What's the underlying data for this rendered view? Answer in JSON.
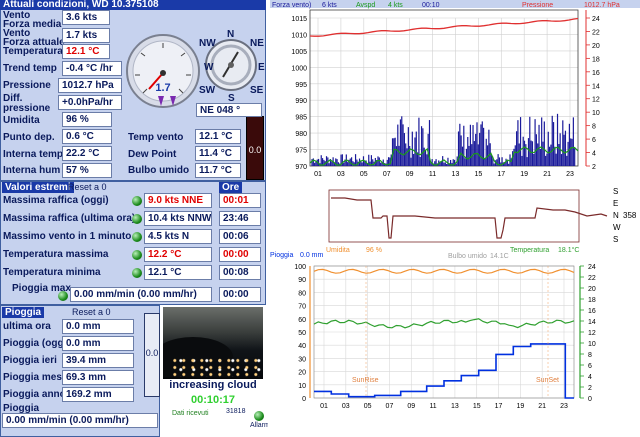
{
  "title": "Attuali condizioni, WD 10.375108",
  "current": {
    "wind_label": "Vento",
    "wind_mean_label": "Forza media",
    "wind_mean_value": "3.6 kts",
    "wind_now_label": "Vento",
    "wind_now_label2": "Forza attuale",
    "wind_now_value": "1.7 kts",
    "temp_label": "Temperatura",
    "temp_value": "12.1 °C",
    "trend_label": "Trend temp",
    "trend_value": "-0.4 °C /hr",
    "pressure_label": "Pressione",
    "pressure_value": "1012.7 hPa",
    "diffp_label": "Diff. pressione",
    "diffp_value": "+0.0hPa/hr",
    "humidity_label": "Umidita",
    "humidity_value": "96 %",
    "dew_label": "Punto dep.",
    "dew_value": "0.6 °C",
    "intemp_label": "Interna temp",
    "intemp_value": "22.2 °C",
    "inhum_label": "Interna hum",
    "inhum_value": "57 %",
    "windchill_label": "Temp vento",
    "windchill_value": "12.1 °C",
    "dewpoint_label": "Dew Point",
    "dewpoint_value": "11.4 °C",
    "wetbulb_label": "Bulbo umido",
    "wetbulb_value": "11.7 °C",
    "gauge_value": "1.7",
    "direction_value": "NE  048 °",
    "side_meter": "0.0"
  },
  "compass": {
    "n": "N",
    "ne": "NE",
    "e": "E",
    "se": "SE",
    "s": "S",
    "sw": "SW",
    "w": "W",
    "nw": "NW"
  },
  "extremes": {
    "header": "Valori estremi",
    "reset": "Reset a 0",
    "ore_header": "Ore",
    "rows": [
      {
        "label": "Massima raffica (oggi)",
        "value": "9.0 kts NNE",
        "time": "00:01"
      },
      {
        "label": "Massima raffica (ultima ora)",
        "value": "10.4 kts NNW",
        "time": "23:46"
      },
      {
        "label": "Massimo vento in 1 minuto",
        "value": "4.5 kts   N",
        "time": "00:06"
      },
      {
        "label": "Temperatura massima",
        "value": "12.2 °C",
        "time": "00:00"
      },
      {
        "label": "Temperatura minima",
        "value": "12.1 °C",
        "time": "00:08"
      }
    ],
    "rain_max_label": "Pioggia max",
    "rain_max_value": "0.00 mm/min (0.00 mm/hr)",
    "rain_max_time": "00:00"
  },
  "rain": {
    "header": "Pioggia",
    "reset": "Reset a 0",
    "rows": [
      {
        "label": "ultima ora",
        "value": "0.0 mm"
      },
      {
        "label": "Pioggia (oggi)",
        "value": "0.0 mm"
      },
      {
        "label": "Pioggia ieri",
        "value": "39.4 mm"
      },
      {
        "label": "Pioggia mese",
        "value": "69.3 mm"
      },
      {
        "label": "Pioggia anno",
        "value": "169.2 mm"
      }
    ],
    "rate_label": "Pioggia",
    "rate_value": "0.00 mm/min (0.00 mm/hr)",
    "side_meter": "0.0"
  },
  "webcam": {
    "caption": "increasing cloud",
    "time": "00:10:17",
    "data_label": "Dati ricevuti",
    "data_count": "31818",
    "alarm_label": "Allarm"
  },
  "top_chart": {
    "legend": [
      "Forza vento)",
      "6 kts",
      "Avspd",
      "4 kts",
      "00:10",
      "Pressione",
      "1012.7 hPa"
    ],
    "y_left": [
      "1015",
      "1010",
      "1005",
      "1000",
      "995",
      "990",
      "985",
      "980",
      "975",
      "970"
    ],
    "y_right": [
      "24",
      "22",
      "20",
      "18",
      "16",
      "14",
      "12",
      "10",
      "8",
      "6",
      "4",
      "2"
    ],
    "x": [
      "01",
      "03",
      "05",
      "07",
      "09",
      "11",
      "13",
      "15",
      "17",
      "19",
      "21",
      "23"
    ]
  },
  "dir_chart": {
    "labels": [
      "S",
      "E",
      "N",
      "W",
      "S"
    ],
    "value": "358"
  },
  "bottom_chart": {
    "legend_rain": "Pioggia",
    "legend_rain_val": "0.0 mm",
    "legend_hum": "Umidita",
    "legend_hum_val": "96 %",
    "legend_dew": "Bulbo umido",
    "legend_dew_val": "14.1C",
    "legend_temp": "Temperatura",
    "legend_temp_val": "18.1°C",
    "y_left": [
      "100",
      "90",
      "80",
      "70",
      "60",
      "50",
      "40",
      "30",
      "20",
      "10",
      "0"
    ],
    "y_right": [
      "24",
      "22",
      "20",
      "18",
      "16",
      "14",
      "12",
      "10",
      "8",
      "6",
      "4",
      "2",
      "0"
    ],
    "x": [
      "01",
      "03",
      "05",
      "07",
      "09",
      "11",
      "13",
      "15",
      "17",
      "19",
      "21",
      "23"
    ],
    "sunrise": "SunRise",
    "sunset": "SunSet"
  },
  "colors": {
    "panel": "#c6d2ee",
    "header": "#1a3aa8",
    "pressure": "#e03030",
    "wind_blue": "#1a1a9a",
    "avg_green": "#1a9a1a",
    "humidity_orange": "#f09030",
    "temp_green": "#30a030",
    "rain_blue": "#0030e0",
    "direction": "#7a2a2a"
  }
}
